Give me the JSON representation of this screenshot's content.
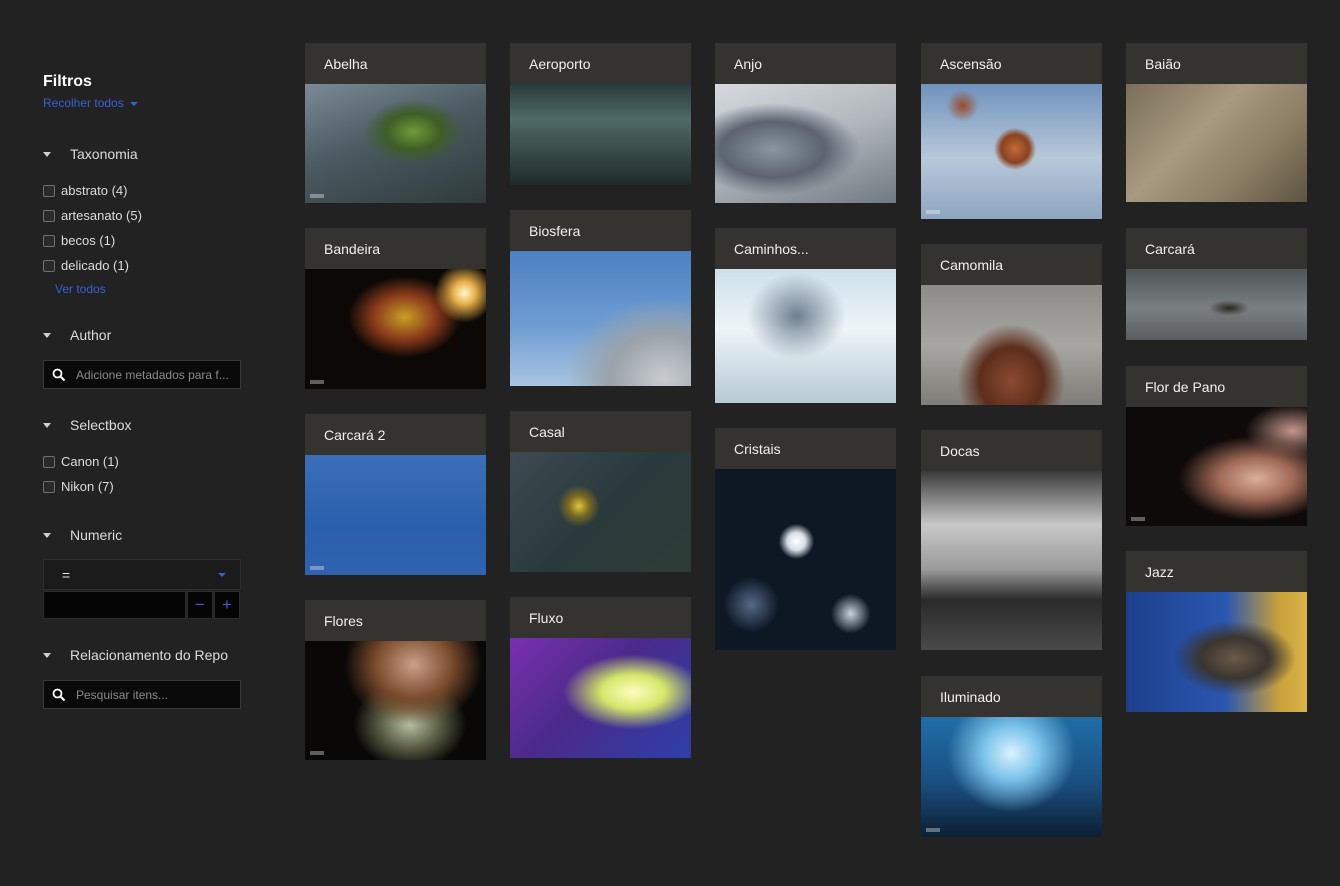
{
  "sidebar": {
    "title": "Filtros",
    "collapse_all": "Recolher todos",
    "taxonomy": {
      "label": "Taxonomia",
      "items": [
        "abstrato (4)",
        "artesanato (5)",
        "becos (1)",
        "delicado (1)"
      ],
      "see_all": "Ver todos"
    },
    "author": {
      "label": "Author",
      "placeholder": "Adicione metadados para f..."
    },
    "selectbox": {
      "label": "Selectbox",
      "items": [
        "Canon (1)",
        "Nikon (7)"
      ]
    },
    "numeric": {
      "label": "Numeric",
      "operator": "=",
      "minus": "−",
      "plus": "+"
    },
    "relationship": {
      "label": "Relacionamento do Repo",
      "placeholder": "Pesquisar itens..."
    }
  },
  "items": [
    "Abelha",
    "Aeroporto",
    "Anjo",
    "Ascensão",
    "Baião",
    "Bandeira",
    "Biosfera",
    "Caminhos...",
    "Camomila",
    "Carcará",
    "Carcará 2",
    "Casal",
    "Cristais",
    "Docas",
    "Flor de Pano",
    "Flores",
    "Fluxo",
    "Iluminado",
    "Jazz"
  ]
}
